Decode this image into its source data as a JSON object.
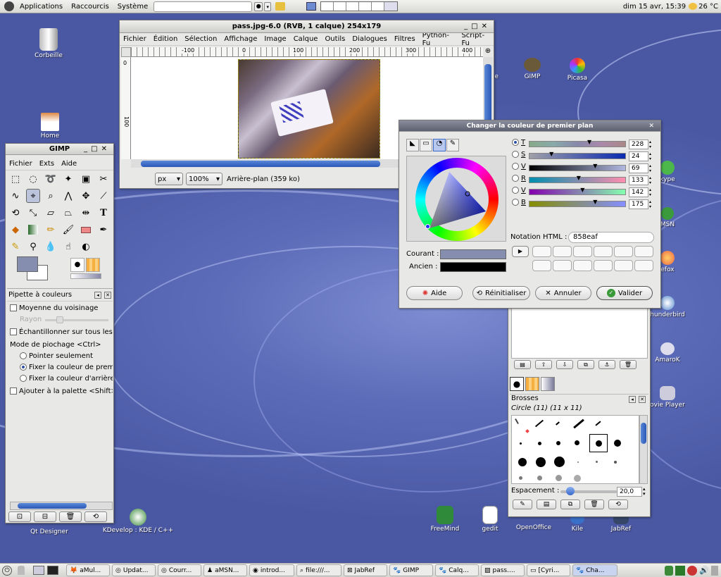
{
  "topbar": {
    "menus": [
      "Applications",
      "Raccourcis",
      "Système"
    ],
    "clock": "dim 15 avr, 15:39",
    "weather": "26 °C"
  },
  "desktop_icons": [
    "Corbeille",
    "Home",
    "Qt Designer",
    "KDevelop : KDE / C++",
    "GIMP",
    "Picasa",
    "eme",
    "kype",
    "MSN",
    "efox",
    "hunderbird",
    "AmaroK",
    "ovie Player",
    "FreeMind",
    "gedit",
    "OpenOffice",
    "Kile",
    "JabRef"
  ],
  "image_window": {
    "title": "pass.jpg-6.0 (RVB, 1 calque) 254x179",
    "menus": [
      "Fichier",
      "Édition",
      "Sélection",
      "Affichage",
      "Image",
      "Calque",
      "Outils",
      "Dialogues",
      "Filtres",
      "Python-Fu",
      "Script-Fu"
    ],
    "ruler_labels": [
      "-100",
      "0",
      "100",
      "200",
      "300",
      "400"
    ],
    "vruler_labels": [
      "0",
      "100"
    ],
    "unit": "px",
    "zoom": "100%",
    "status": "Arrière-plan (359 ko)"
  },
  "toolbox": {
    "title": "GIMP",
    "menus": [
      "Fichier",
      "Exts",
      "Aide"
    ],
    "fg_color": "#858eaf",
    "bg_color": "#ffffff",
    "tools": [
      "rect-select",
      "ellipse-select",
      "lasso",
      "fuzzy-select",
      "color-select",
      "scissors",
      "paths",
      "color-picker",
      "zoom",
      "measure",
      "move",
      "crop",
      "rotate",
      "scale",
      "shear",
      "perspective",
      "flip",
      "text",
      "bucket-fill",
      "blend",
      "pencil",
      "paintbrush",
      "eraser",
      "airbrush",
      "ink",
      "clone",
      "blur",
      "smudge",
      "dodge-burn",
      "heal"
    ]
  },
  "picker_options": {
    "title": "Pipette à couleurs",
    "average": "Moyenne du voisinage",
    "radius": "Rayon",
    "sample_merged": "Échantillonner sur tous les c",
    "mode_label": "Mode de piochage <Ctrl>",
    "mode_options": [
      "Pointer seulement",
      "Fixer la couleur de premi",
      "Fixer la couleur d'arrière-p"
    ],
    "mode_selected": 1,
    "add_palette": "Ajouter à la palette <Shift>"
  },
  "color_dialog": {
    "title": "Changer la couleur de premier plan",
    "channels": [
      {
        "label": "T",
        "value": "228",
        "level": 0.63
      },
      {
        "label": "S",
        "value": "24",
        "level": 0.24
      },
      {
        "label": "V",
        "value": "69",
        "level": 0.69
      },
      {
        "label": "R",
        "value": "133",
        "level": 0.52
      },
      {
        "label": "V",
        "value": "142",
        "level": 0.56
      },
      {
        "label": "B",
        "value": "175",
        "level": 0.69
      }
    ],
    "html_label": "Notation HTML :",
    "html_value": "858eaf",
    "current_label": "Courant :",
    "old_label": "Ancien :",
    "current_color": "#858eaf",
    "old_color": "#000000",
    "buttons": {
      "help": "Aide",
      "reset": "Réinitialiser",
      "cancel": "Annuler",
      "ok": "Valider"
    }
  },
  "brushes": {
    "title": "Brosses",
    "selected": "Circle (11) (11 x 11)",
    "spacing_label": "Espacement :",
    "spacing_value": "20,0"
  },
  "taskbar": {
    "tasks": [
      "aMul...",
      "Updat...",
      "Courr...",
      "aMSN...",
      "introd...",
      "file:///...",
      "JabRef",
      "GIMP",
      "Calq...",
      "pass....",
      "[Cyri...",
      "Cha..."
    ]
  }
}
